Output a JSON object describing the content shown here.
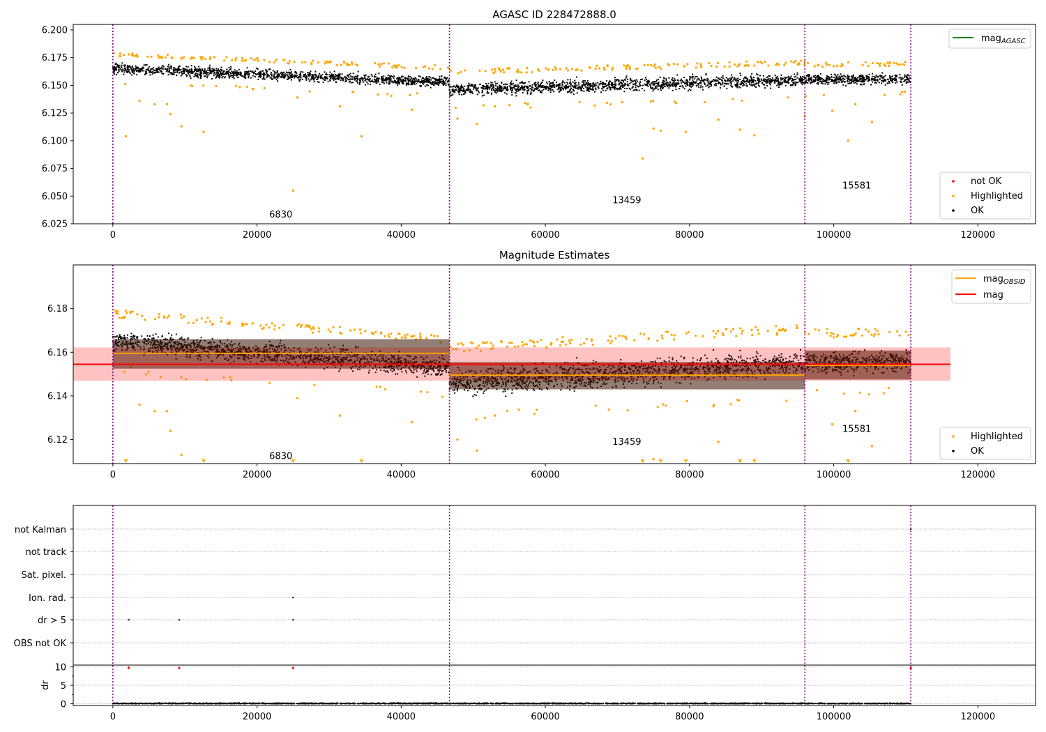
{
  "colors": {
    "ok": "#000000",
    "highlighted": "#ffa500",
    "not_ok": "#ff0000",
    "agasc_line": "#008000",
    "obsid_line": "#ffa500",
    "mag_line": "#ff0000",
    "obs_separator": "#800080"
  },
  "chart_data": [
    {
      "type": "scatter",
      "title": "AGASC ID 228472888.0",
      "xlim": [
        -5500,
        128000
      ],
      "ylim": [
        6.025,
        6.205
      ],
      "xticks": [
        0,
        20000,
        40000,
        60000,
        80000,
        100000,
        120000
      ],
      "xtick_labels": [
        "0",
        "20000",
        "40000",
        "60000",
        "80000",
        "100000",
        "120000"
      ],
      "yticks": [
        6.025,
        6.05,
        6.075,
        6.1,
        6.125,
        6.15,
        6.175,
        6.2
      ],
      "ytick_labels": [
        "6.025",
        "6.050",
        "6.075",
        "6.100",
        "6.125",
        "6.150",
        "6.175",
        "6.200"
      ],
      "obs_boundaries": [
        0,
        46700,
        96000,
        110700
      ],
      "obs_labels": [
        {
          "text": "6830",
          "x": 23300,
          "y": 6.0335
        },
        {
          "text": "13459",
          "x": 71300,
          "y": 6.0465
        },
        {
          "text": "15581",
          "x": 103200,
          "y": 6.0595
        }
      ],
      "segments": [
        {
          "x0": 0,
          "x1": 46700,
          "center_start": 6.165,
          "center_end": 6.153,
          "half_width": 0.0105
        },
        {
          "x0": 46700,
          "x1": 96000,
          "center_start": 6.146,
          "center_end": 6.155,
          "half_width": 0.013
        },
        {
          "x0": 96000,
          "x1": 110700,
          "center_start": 6.155,
          "center_end": 6.156,
          "half_width": 0.011
        }
      ],
      "highlighted_outliers": [
        [
          1800,
          6.104
        ],
        [
          3700,
          6.136
        ],
        [
          5800,
          6.133
        ],
        [
          7500,
          6.133
        ],
        [
          8000,
          6.124
        ],
        [
          9500,
          6.113
        ],
        [
          12600,
          6.108
        ],
        [
          25000,
          6.055
        ],
        [
          25600,
          6.139
        ],
        [
          31500,
          6.131
        ],
        [
          34500,
          6.104
        ],
        [
          41500,
          6.128
        ],
        [
          47800,
          6.12
        ],
        [
          50500,
          6.115
        ],
        [
          53000,
          6.131
        ],
        [
          73500,
          6.084
        ],
        [
          75000,
          6.111
        ],
        [
          76000,
          6.109
        ],
        [
          79500,
          6.108
        ],
        [
          84000,
          6.119
        ],
        [
          87000,
          6.11
        ],
        [
          89000,
          6.105
        ],
        [
          96000,
          6.122
        ],
        [
          99800,
          6.127
        ],
        [
          102000,
          6.1
        ],
        [
          103000,
          6.133
        ],
        [
          105300,
          6.117
        ]
      ],
      "legend_top": [
        {
          "label": "mag",
          "subscript": "AGASC",
          "color": "#008000"
        }
      ],
      "legend_bottom": [
        {
          "label": "not OK",
          "color": "#ff0000"
        },
        {
          "label": "Highlighted",
          "color": "#ffa500"
        },
        {
          "label": "OK",
          "color": "#000000"
        }
      ]
    },
    {
      "type": "scatter",
      "title": "Magnitude Estimates",
      "xlim": [
        -5500,
        128000
      ],
      "ylim": [
        6.109,
        6.2
      ],
      "xticks": [
        0,
        20000,
        40000,
        60000,
        80000,
        100000,
        120000
      ],
      "xtick_labels": [
        "0",
        "20000",
        "40000",
        "60000",
        "80000",
        "100000",
        "120000"
      ],
      "yticks": [
        6.12,
        6.14,
        6.16,
        6.18
      ],
      "ytick_labels": [
        "6.12",
        "6.14",
        "6.16",
        "6.18"
      ],
      "obs_boundaries": [
        0,
        46700,
        96000,
        110700
      ],
      "obs_labels": [
        {
          "text": "6830",
          "x": 23300,
          "y": 6.1125
        },
        {
          "text": "13459",
          "x": 71300,
          "y": 6.119
        },
        {
          "text": "15581",
          "x": 103200,
          "y": 6.125
        }
      ],
      "mag": {
        "value": 6.1545,
        "band": [
          6.147,
          6.1622
        ],
        "x0": -5500,
        "x1": 116200
      },
      "obsid_mags": [
        {
          "x0": 0,
          "x1": 46700,
          "value": 6.1595,
          "band": [
            6.1525,
            6.166
          ]
        },
        {
          "x0": 46700,
          "x1": 96000,
          "value": 6.1495,
          "band": [
            6.143,
            6.1555
          ]
        },
        {
          "x0": 96000,
          "x1": 110700,
          "value": 6.154,
          "band": [
            6.1475,
            6.1608
          ]
        }
      ],
      "legend_top": [
        {
          "label": "mag",
          "subscript": "OBSID",
          "color": "#ffa500"
        },
        {
          "label": "mag",
          "color": "#ff0000"
        }
      ],
      "legend_bottom": [
        {
          "label": "Highlighted",
          "color": "#ffa500"
        },
        {
          "label": "OK",
          "color": "#000000"
        }
      ],
      "clipped_markers_x": [
        1800,
        12600,
        25000,
        34500,
        73500,
        76000,
        79500,
        87000,
        89000,
        102000
      ]
    },
    {
      "type": "scatter",
      "title": "",
      "xlim": [
        -5500,
        128000
      ],
      "xticks": [
        0,
        20000,
        40000,
        60000,
        80000,
        100000,
        120000
      ],
      "xtick_labels": [
        "0",
        "20000",
        "40000",
        "60000",
        "80000",
        "100000",
        "120000"
      ],
      "flag_rows": [
        "not Kalman",
        "not track",
        "Sat. pixel.",
        "Ion. rad.",
        "dr > 5",
        "OBS not OK"
      ],
      "flag_points": [
        {
          "row": "Ion. rad.",
          "x": 25000
        },
        {
          "row": "dr > 5",
          "x": 2200
        },
        {
          "row": "dr > 5",
          "x": 9200
        },
        {
          "row": "dr > 5",
          "x": 25000
        },
        {
          "row": "not Kalman",
          "x": 110700
        }
      ],
      "dr_ylabel": "dr",
      "dr_ylim": [
        -0.5,
        10.5
      ],
      "dr_yticks": [
        0,
        5,
        10
      ],
      "dr_ytick_labels": [
        "0",
        "5",
        "10"
      ],
      "dr_markers": [
        [
          2200,
          9.8
        ],
        [
          9200,
          9.8
        ],
        [
          25000,
          9.8
        ],
        [
          110700,
          9.8
        ]
      ],
      "obs_boundaries": [
        0,
        46700,
        96000,
        110700
      ]
    }
  ]
}
